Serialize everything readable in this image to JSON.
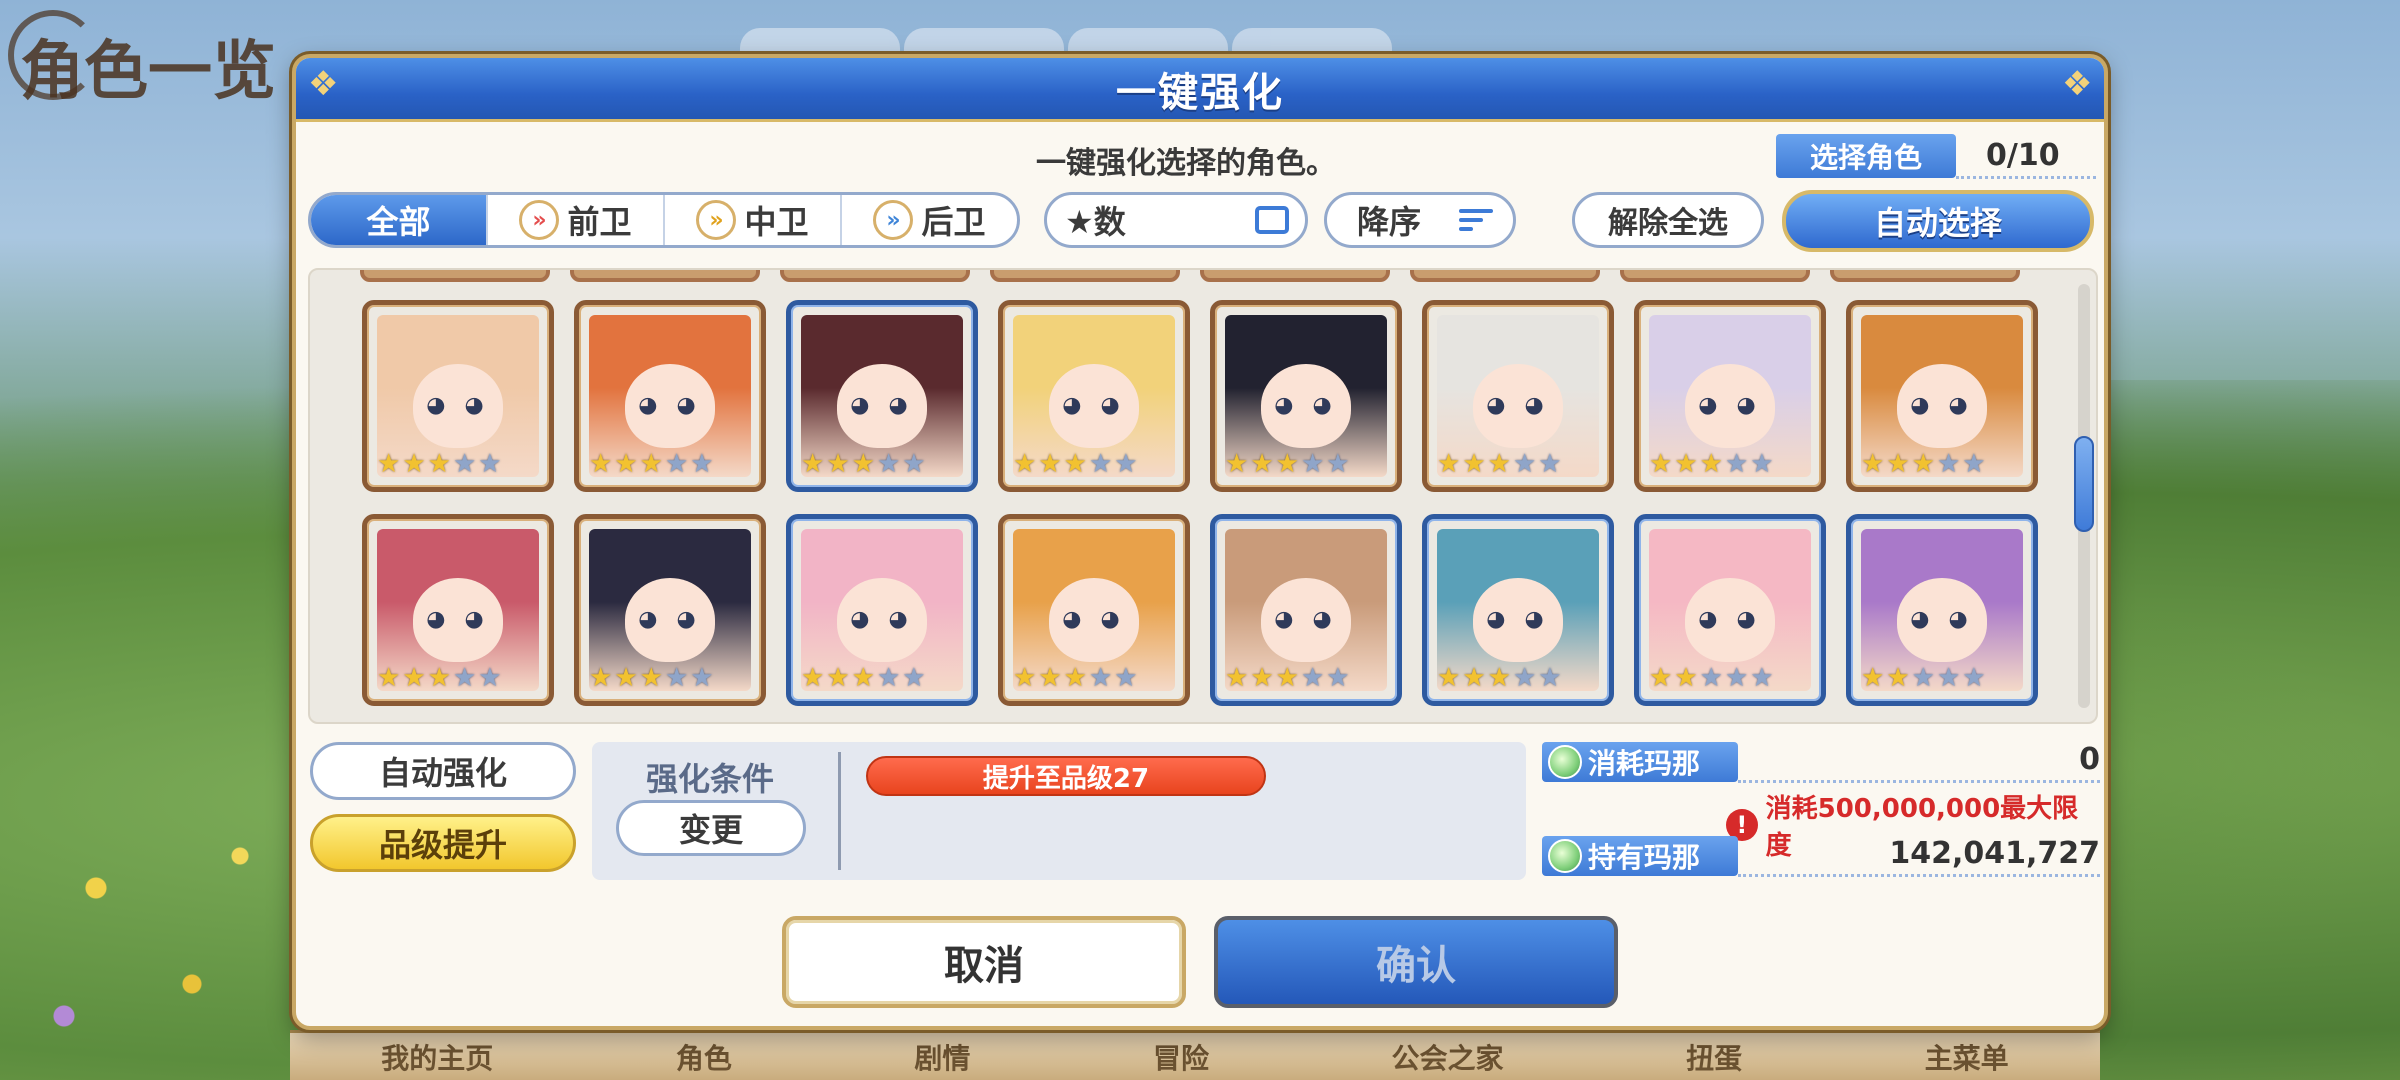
{
  "background": {
    "title": "角色一览",
    "bottom_nav": [
      "我的主页",
      "角色",
      "剧情",
      "冒险",
      "公会之家",
      "扭蛋",
      "主菜单"
    ]
  },
  "modal": {
    "title": "一键强化",
    "subtitle": "一键强化选择的角色。",
    "select_label": "选择角色",
    "select_count": "0/10"
  },
  "filters": {
    "tabs": [
      {
        "label": "全部",
        "icon": ""
      },
      {
        "label": "前卫",
        "icon": "front-role-icon"
      },
      {
        "label": "中卫",
        "icon": "middle-role-icon"
      },
      {
        "label": "后卫",
        "icon": "back-role-icon"
      }
    ],
    "sort_key": "★数",
    "sort_order": "降序",
    "clear_all": "解除全选",
    "auto_select": "自动选择"
  },
  "characters": [
    {
      "frame": "bronze",
      "stars": 3,
      "hair": "#f0c9a8"
    },
    {
      "frame": "bronze",
      "stars": 3,
      "hair": "#e2733e"
    },
    {
      "frame": "blue",
      "stars": 3,
      "hair": "#5a2a2e"
    },
    {
      "frame": "bronze",
      "stars": 3,
      "hair": "#f2d27a"
    },
    {
      "frame": "bronze",
      "stars": 3,
      "hair": "#222230"
    },
    {
      "frame": "bronze",
      "stars": 3,
      "hair": "#e6e4e0"
    },
    {
      "frame": "bronze",
      "stars": 3,
      "hair": "#d9cfe8"
    },
    {
      "frame": "bronze",
      "stars": 3,
      "hair": "#d98a3e"
    },
    {
      "frame": "bronze",
      "stars": 3,
      "hair": "#c95a6a"
    },
    {
      "frame": "bronze",
      "stars": 3,
      "hair": "#2b2a40"
    },
    {
      "frame": "blue",
      "stars": 3,
      "hair": "#f2b4c6"
    },
    {
      "frame": "bronze",
      "stars": 3,
      "hair": "#e8a14a"
    },
    {
      "frame": "blue",
      "stars": 3,
      "hair": "#c99b7a"
    },
    {
      "frame": "blue",
      "stars": 3,
      "hair": "#5aa0b8"
    },
    {
      "frame": "blue",
      "stars": 2,
      "hair": "#f5b8c4"
    },
    {
      "frame": "blue",
      "stars": 2,
      "hair": "#a979c9"
    }
  ],
  "max_stars": 5,
  "controls": {
    "auto_enhance": "自动强化",
    "grade_up": "品级提升",
    "condition_label": "强化条件",
    "change": "变更",
    "condition_tag": "提升至品级27"
  },
  "mana": {
    "consume_label": "消耗玛那",
    "consume_value": "0",
    "warning": "消耗500,000,000最大限度",
    "have_label": "持有玛那",
    "have_value": "142,041,727"
  },
  "actions": {
    "cancel": "取消",
    "confirm": "确认"
  },
  "colors": {
    "header_blue": "#2a62c7",
    "gold_border": "#c9a865",
    "grade_up_yellow": "#f2c72d",
    "warning_red": "#d62a2a",
    "condition_orange": "#e8441e"
  }
}
